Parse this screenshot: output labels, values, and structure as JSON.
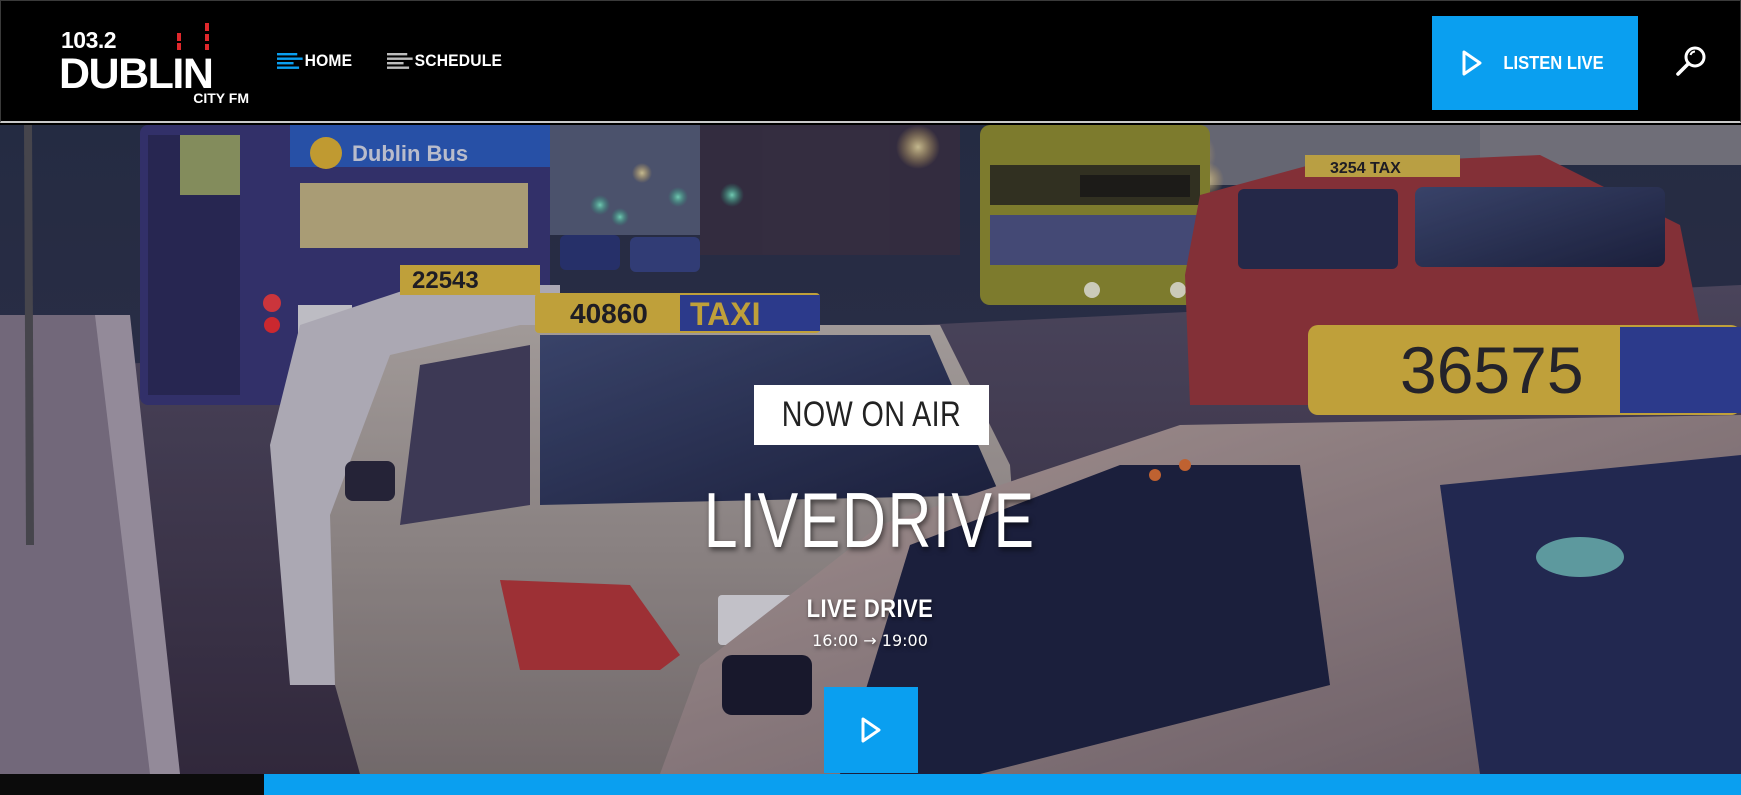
{
  "brand": {
    "frequency": "103.2",
    "name": "DUBLIN",
    "sub": "CITY FM",
    "accent_color": "#0a9ff0",
    "bars_color": "#e0282c"
  },
  "nav": {
    "items": [
      {
        "label": "HOME",
        "icon": "bars-icon",
        "active": true
      },
      {
        "label": "SCHEDULE",
        "icon": "bars-icon",
        "active": false
      }
    ]
  },
  "header": {
    "listen_label": "LISTEN LIVE",
    "search_icon": "search-icon"
  },
  "hero": {
    "badge": "NOW ON AIR",
    "title": "LIVEDRIVE",
    "show": "LIVE DRIVE",
    "time": "16:00 → 19:00",
    "taxi_plates": [
      "22543",
      "40860",
      "36575"
    ],
    "taxi_word": "TAXI",
    "bus_operator": "Dublin Bus"
  }
}
